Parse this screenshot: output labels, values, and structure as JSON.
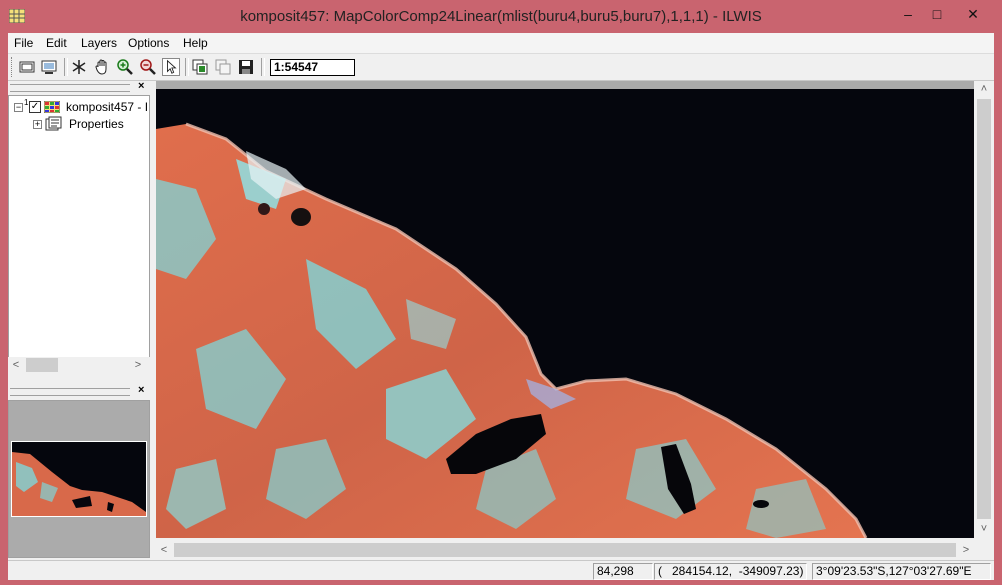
{
  "window": {
    "title": "komposit457: MapColorComp24Linear(mlist(buru4,buru5,buru7),1,1,1) - ILWIS",
    "minimize": "–",
    "maximize": "□",
    "close": "✕"
  },
  "menu": {
    "items": [
      "File",
      "Edit",
      "Layers",
      "Options",
      "Help"
    ]
  },
  "toolbar": {
    "scale_value": "1:54547"
  },
  "panel": {
    "close_glyph": "×",
    "layer_name": "komposit457 - I",
    "layer_index": "1",
    "properties_label": "Properties",
    "expand_glyph": "−",
    "collapse_glyph": "+"
  },
  "scroll": {
    "left": "<",
    "right": ">",
    "up": "˄",
    "down": "˅"
  },
  "status": {
    "rowcol": "84,298",
    "coords": "(   284154.12,  -349097.23)",
    "latlon": "3°09'23.53\"S,127°03'27.69\"E"
  },
  "colors": {
    "frame": "#c9646f",
    "sea": "#05060d",
    "land_red": "#d8694a",
    "land_cyan": "#7fd6d8"
  }
}
